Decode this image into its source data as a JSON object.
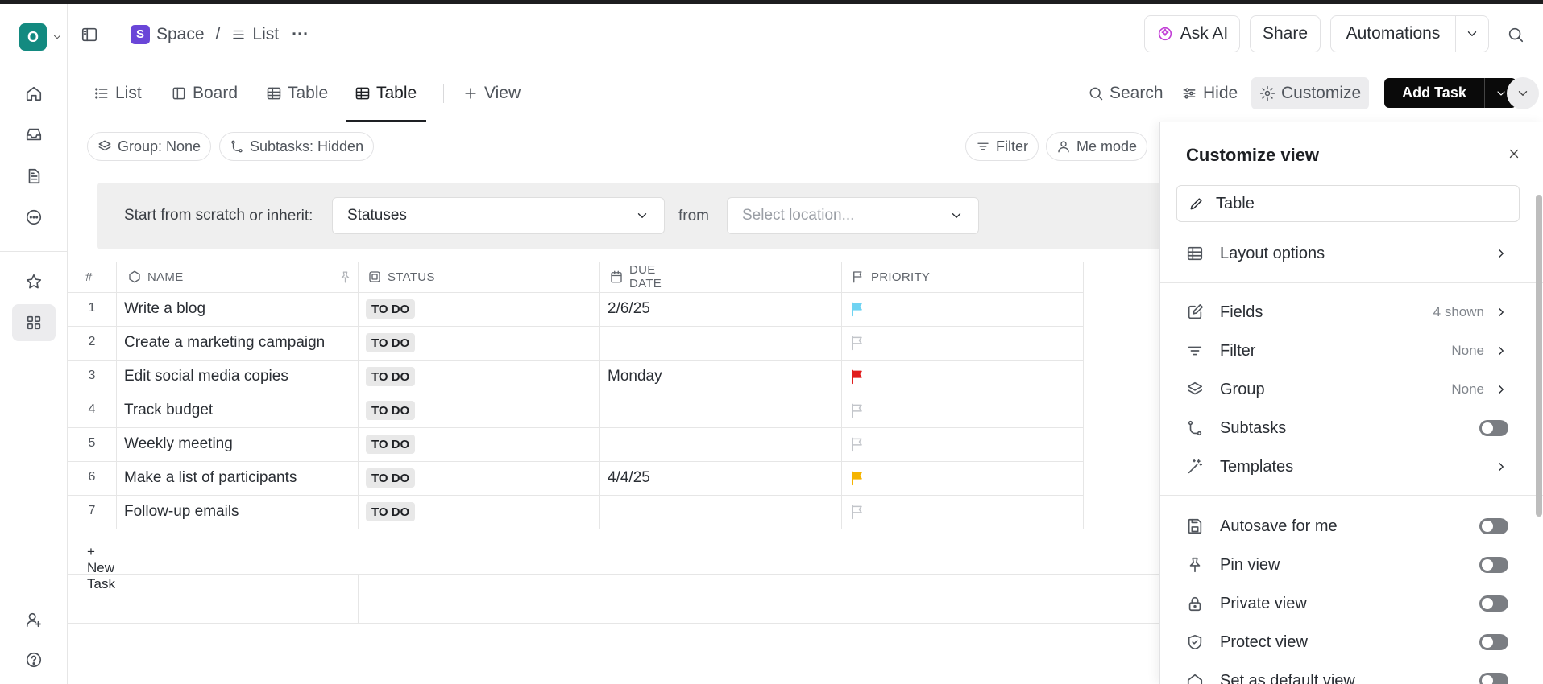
{
  "workspace": {
    "initial": "O"
  },
  "breadcrumb": {
    "space_badge": "S",
    "space": "Space",
    "separator": "/",
    "list": "List",
    "more": "···"
  },
  "header": {
    "ask_ai": "Ask AI",
    "share": "Share",
    "automations": "Automations"
  },
  "tabs": [
    {
      "label": "List"
    },
    {
      "label": "Board"
    },
    {
      "label": "Table"
    },
    {
      "label": "Table"
    },
    {
      "label": "View"
    }
  ],
  "toolbar": {
    "search": "Search",
    "hide": "Hide",
    "customize": "Customize",
    "add_task": "Add Task"
  },
  "filters": {
    "group": "Group: None",
    "subtasks": "Subtasks: Hidden",
    "filter": "Filter",
    "me_mode": "Me mode"
  },
  "banner": {
    "start": "Start from scratch",
    "or_inherit": " or inherit:",
    "statuses": "Statuses",
    "from": "from",
    "location_placeholder": "Select location..."
  },
  "table": {
    "columns": {
      "num": "#",
      "name": "NAME",
      "status": "STATUS",
      "due": "DUE DATE",
      "priority": "PRIORITY"
    },
    "rows": [
      {
        "num": "1",
        "name": "Write a blog",
        "status": "TO DO",
        "due": "2/6/25",
        "priority": "low"
      },
      {
        "num": "2",
        "name": "Create a marketing campaign",
        "status": "TO DO",
        "due": "",
        "priority": "none"
      },
      {
        "num": "3",
        "name": "Edit social media copies",
        "status": "TO DO",
        "due": "Monday",
        "priority": "urgent"
      },
      {
        "num": "4",
        "name": "Track budget",
        "status": "TO DO",
        "due": "",
        "priority": "none"
      },
      {
        "num": "5",
        "name": "Weekly meeting",
        "status": "TO DO",
        "due": "",
        "priority": "none"
      },
      {
        "num": "6",
        "name": "Make a list of participants",
        "status": "TO DO",
        "due": "4/4/25",
        "priority": "high"
      },
      {
        "num": "7",
        "name": "Follow-up emails",
        "status": "TO DO",
        "due": "",
        "priority": "none"
      }
    ],
    "new_task": "+ New Task"
  },
  "priority_colors": {
    "low": "#6fd3f2",
    "urgent": "#e11d1d",
    "high": "#f5b400",
    "none": "#c2c5ca"
  },
  "panel": {
    "title": "Customize view",
    "view_name": "Table",
    "layout_options": "Layout options",
    "fields": "Fields",
    "fields_value": "4 shown",
    "filter": "Filter",
    "filter_value": "None",
    "group": "Group",
    "group_value": "None",
    "subtasks": "Subtasks",
    "templates": "Templates",
    "autosave": "Autosave for me",
    "pin_view": "Pin view",
    "private_view": "Private view",
    "protect_view": "Protect view",
    "default_view": "Set as default view"
  }
}
